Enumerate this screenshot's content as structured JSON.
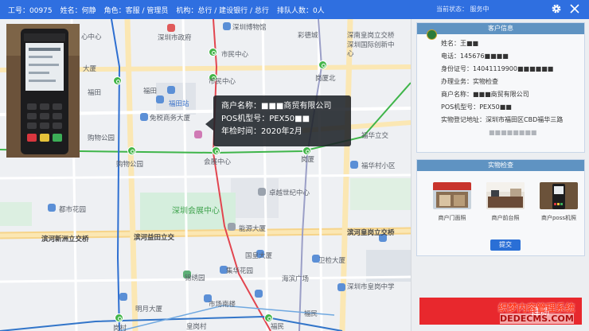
{
  "topbar": {
    "staff_id": "工号：00975",
    "name": "姓名：何静",
    "role": "角色：客服 / 管理员",
    "org": "机构：总行 / 建设银行 / 总行",
    "queue": "排队人数：0人",
    "state": "当前状态：  服务中",
    "icons": [
      "gear-icon",
      "close-icon"
    ]
  },
  "map": {
    "labels": {
      "l1": "心中心",
      "l2": "深圳市政府",
      "l3": "深圳博物馆",
      "l4": "彩德城",
      "l5": "深南皇岗立交桥",
      "l6": "市民中心",
      "l7": "深圳国际创新中心",
      "l8": "大厦",
      "l9": "市民中心",
      "l10": "岗厦北",
      "l11": "福田",
      "l12": "福田",
      "l13": "福田站",
      "l14": "免税商务大厦",
      "l15": "购物公园",
      "l16": "购物公园",
      "l17": "会展中心",
      "l18": "岗厦",
      "l19": "福华立交",
      "l20": "福华村小区",
      "l21": "卓越世纪中心",
      "l22": "深圳会展中心",
      "l23": "都市花园",
      "l24": "能源大厦",
      "l25": "滨河新洲立交桥",
      "l26": "滨河益田立交",
      "l27": "滨河皇岗立交桥",
      "l28": "国皇大厦",
      "l29": "卫检大厦",
      "l30": "集华花园",
      "l31": "锦绣园",
      "l32": "海滨广场",
      "l33": "深圳市皇岗中学",
      "l34": "市场南楼",
      "l35": "明月大厦",
      "l36": "皇岗村",
      "l37": "岗村",
      "l38": "福民",
      "l39": "福民"
    }
  },
  "tooltip": {
    "merchant_label": "商户名称：",
    "merchant_value": "■■■商贸有限公司",
    "pos_label": "POS机型号：",
    "pos_value": "PEX50■■",
    "year_label": "年检时间：",
    "year_value": "2020年2月"
  },
  "customer_card": {
    "title": "客户信息",
    "name_label": "姓名：",
    "name_value": "王■■",
    "phone_label": "电话：",
    "phone_value": "145676■■■■",
    "id_label": "身份证号：",
    "id_value": "14041119900■■■■■■",
    "business_label": "办理业务：",
    "business_value": "实物检查",
    "merchant_label": "商户名称：",
    "merchant_value": "■■■商贸有限公司",
    "pos_label": "POS机型号：",
    "pos_value": "PEX50■■",
    "address_label": "实物登记地址：",
    "address_value": "深圳市福田区CBD福华三路",
    "address_line2": "■■■■■■■■"
  },
  "inspection_card": {
    "title": "实物检查",
    "thumbs": [
      {
        "caption": "商户门面照"
      },
      {
        "caption": "商户前台照"
      },
      {
        "caption": "商户poss机照"
      }
    ],
    "submit": "提交"
  },
  "hangup_label": "挂断",
  "watermark": {
    "line1": "织梦内容管理系统",
    "line2": "DEDECMS.COM"
  },
  "colors": {
    "topbar": "#2f6fe0",
    "card_header": "#5f93c2",
    "hangup": "#e8282d",
    "subway": "#43b549"
  }
}
